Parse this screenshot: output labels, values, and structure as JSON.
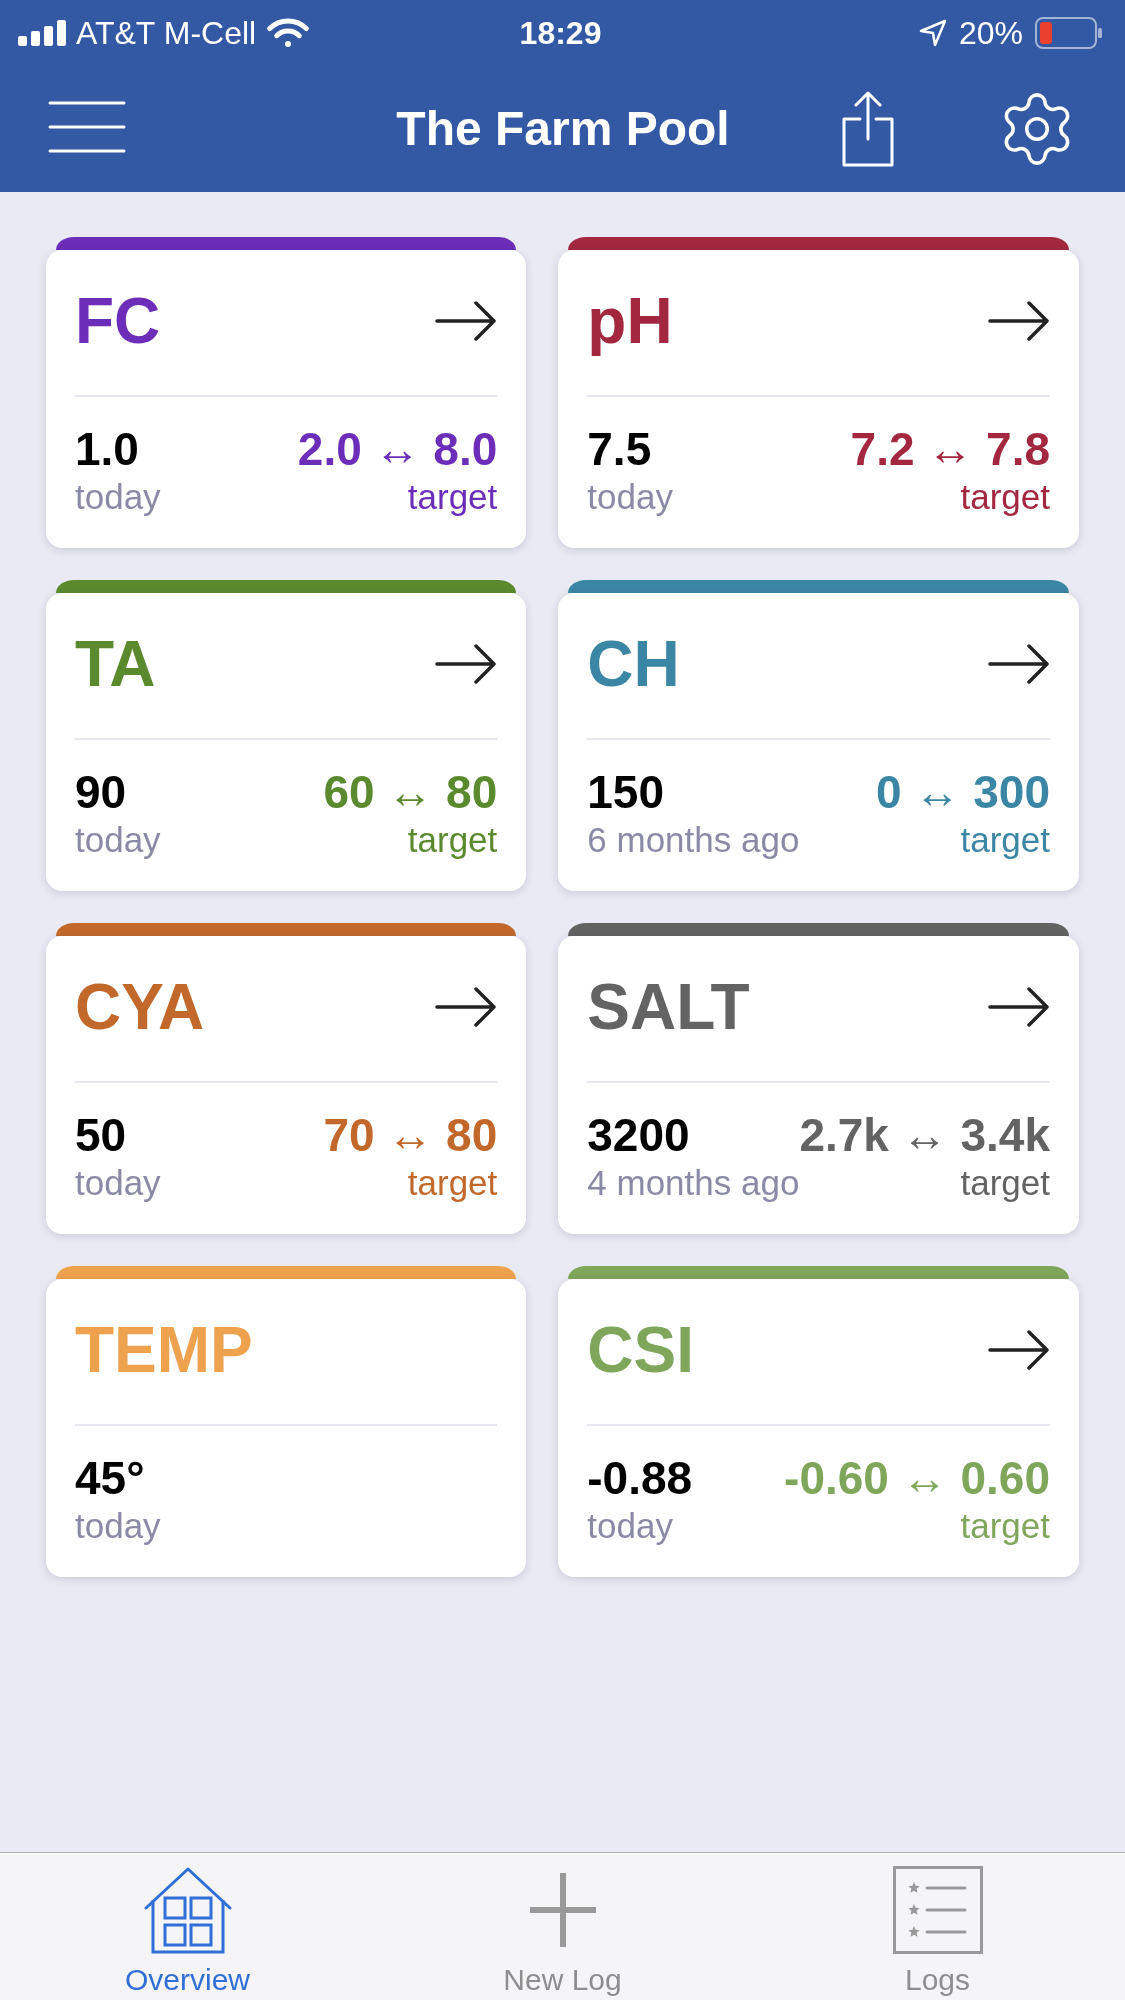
{
  "status_bar": {
    "carrier": "AT&T M-Cell",
    "time": "18:29",
    "battery": "20%"
  },
  "header": {
    "title": "The Farm Pool"
  },
  "cards": [
    {
      "name": "FC",
      "color": "#6c2eb9",
      "detail_arrow": true,
      "value": "1.0",
      "when": "today",
      "target": "2.0 ↔ 8.0",
      "target_label": "target"
    },
    {
      "name": "pH",
      "color": "#a3273f",
      "detail_arrow": true,
      "value": "7.5",
      "when": "today",
      "target": "7.2 ↔ 7.8",
      "target_label": "target"
    },
    {
      "name": "TA",
      "color": "#5b8a2e",
      "detail_arrow": true,
      "value": "90",
      "when": "today",
      "target": "60 ↔ 80",
      "target_label": "target"
    },
    {
      "name": "CH",
      "color": "#3c86a5",
      "detail_arrow": true,
      "value": "150",
      "when": "6 months ago",
      "target": "0 ↔ 300",
      "target_label": "target"
    },
    {
      "name": "CYA",
      "color": "#c2682a",
      "detail_arrow": true,
      "value": "50",
      "when": "today",
      "target": "70 ↔ 80",
      "target_label": "target"
    },
    {
      "name": "SALT",
      "color": "#636363",
      "detail_arrow": true,
      "value": "3200",
      "when": "4 months ago",
      "target": "2.7k ↔ 3.4k",
      "target_label": "target"
    },
    {
      "name": "TEMP",
      "color": "#efa24e",
      "detail_arrow": false,
      "value": "45°",
      "when": "today"
    },
    {
      "name": "CSI",
      "color": "#7fa65a",
      "detail_arrow": true,
      "value": "-0.88",
      "when": "today",
      "target": "-0.60 ↔ 0.60",
      "target_label": "target"
    }
  ],
  "tabs": [
    {
      "label": "Overview",
      "selected": true
    },
    {
      "label": "New Log",
      "selected": false
    },
    {
      "label": "Logs",
      "selected": false
    }
  ]
}
